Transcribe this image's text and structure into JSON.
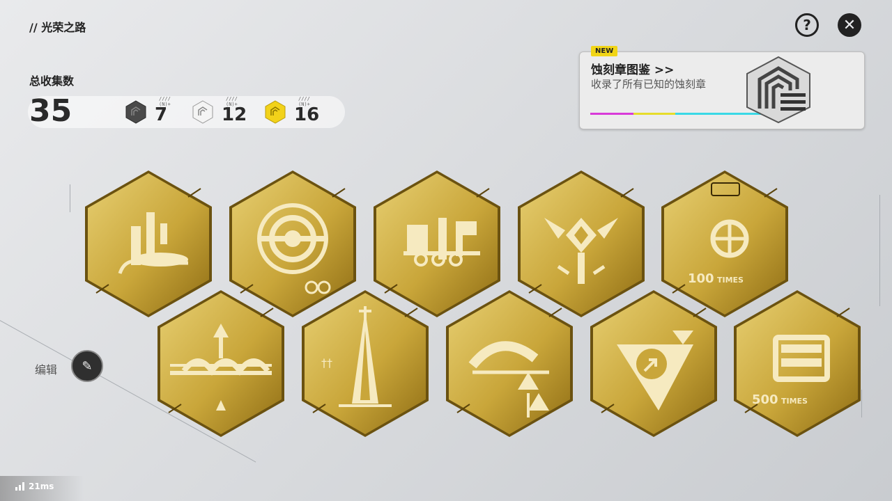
{
  "header": {
    "breadcrumb": "// 光荣之路",
    "help_icon": "question-mark-icon",
    "close_icon": "close-x-icon"
  },
  "summary": {
    "total_label": "总收集数",
    "total_value": "35",
    "tiers": [
      {
        "name": "dark",
        "color": "#4a4a4a",
        "count": "7"
      },
      {
        "name": "silver",
        "color": "#f2f2f2",
        "count": "12"
      },
      {
        "name": "gold",
        "color": "#f2d21a",
        "count": "16"
      }
    ]
  },
  "codex": {
    "badge": "NEW",
    "title": "蚀刻章图鉴 >>",
    "subtitle": "收录了所有已知的蚀刻章",
    "stripe_colors": [
      "#d83ad8",
      "#e6dc2a",
      "#39d8e6"
    ]
  },
  "badges": [
    {
      "name": "badge-1-tower-stairs"
    },
    {
      "name": "badge-2-circle-target"
    },
    {
      "name": "badge-3-machines"
    },
    {
      "name": "badge-4-emblem"
    },
    {
      "name": "badge-5-100-times",
      "caption": "100 TIMES"
    },
    {
      "name": "badge-6-bridge"
    },
    {
      "name": "badge-7-spire"
    },
    {
      "name": "badge-8-wing"
    },
    {
      "name": "badge-9-arrow"
    },
    {
      "name": "badge-10-500-times",
      "caption": "500 TIMES"
    }
  ],
  "edit": {
    "label": "编辑",
    "icon": "edit-pencil-icon"
  },
  "status": {
    "ping": "21ms",
    "signal_icon": "signal-bars-icon"
  },
  "colors": {
    "gold_light": "#e7cf72",
    "gold_mid": "#c9a63a",
    "gold_dark": "#8f6d14",
    "background": "#dcdee1"
  }
}
